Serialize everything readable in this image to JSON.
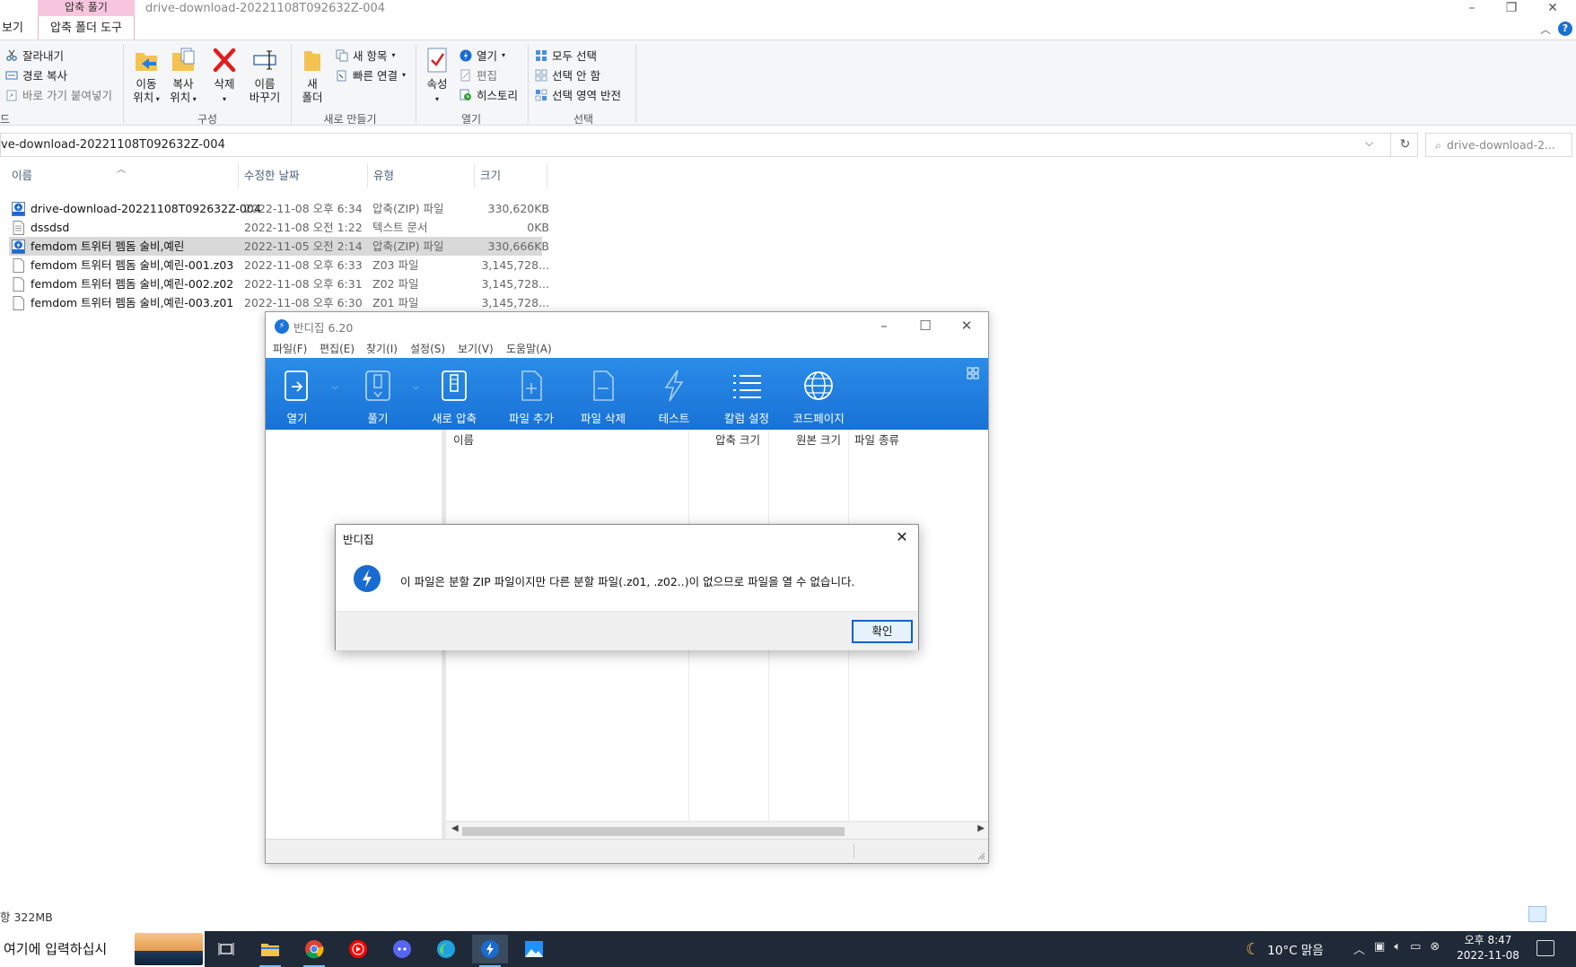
{
  "explorer": {
    "title": "drive-download-20221108T092632Z-004",
    "context_tab_top": "압축 풀기",
    "context_tab": "압축 폴더 도구",
    "view_tab": "보기",
    "ribbon": {
      "clipboard": {
        "cut": "잘라내기",
        "copy_path": "경로 복사",
        "paste_shortcut": "바로 가기 붙여넣기",
        "partial_label": "드"
      },
      "organize": {
        "move_to": "이동\n위치",
        "copy_to": "복사\n위치",
        "delete": "삭제",
        "rename": "이름\n바꾸기",
        "label": "구성"
      },
      "new": {
        "new_folder": "새\n폴더",
        "new_item": "새 항목",
        "easy_access": "빠른 연결",
        "label": "새로 만들기"
      },
      "open": {
        "properties": "속성",
        "open": "열기",
        "edit": "편집",
        "history": "히스토리",
        "label": "열기"
      },
      "select": {
        "select_all": "모두 선택",
        "select_none": "선택 안 함",
        "invert": "선택 영역 반전",
        "label": "선택"
      }
    },
    "address": "ve-download-20221108T092632Z-004",
    "search_placeholder": "drive-download-2...",
    "columns": {
      "name": "이름",
      "date": "수정한 날짜",
      "type": "유형",
      "size": "크기"
    },
    "files": [
      {
        "name": "drive-download-20221108T092632Z-004",
        "date": "2022-11-08 오후 6:34",
        "type": "압축(ZIP) 파일",
        "size": "330,620KB",
        "icon": "zip-icon",
        "selected": false
      },
      {
        "name": "dssdsd",
        "date": "2022-11-08 오전 1:22",
        "type": "텍스트 문서",
        "size": "0KB",
        "icon": "text-file-icon",
        "selected": false
      },
      {
        "name": "femdom 트위터 펨돔 술비,예린",
        "date": "2022-11-05 오전 2:14",
        "type": "압축(ZIP) 파일",
        "size": "330,666KB",
        "icon": "zip-icon",
        "selected": true
      },
      {
        "name": "femdom 트위터 펨돔 술비,예린-001.z03",
        "date": "2022-11-08 오후 6:33",
        "type": "Z03 파일",
        "size": "3,145,728...",
        "icon": "blank-file-icon",
        "selected": false
      },
      {
        "name": "femdom 트위터 펨돔 술비,예린-002.z02",
        "date": "2022-11-08 오후 6:31",
        "type": "Z02 파일",
        "size": "3,145,728...",
        "icon": "blank-file-icon",
        "selected": false
      },
      {
        "name": "femdom 트위터 펨돔 술비,예린-003.z01",
        "date": "2022-11-08 오후 6:30",
        "type": "Z01 파일",
        "size": "3,145,728...",
        "icon": "blank-file-icon",
        "selected": false
      }
    ],
    "status_left": "항 322MB"
  },
  "bandizip": {
    "title": "반디집 6.20",
    "menu": [
      "파일(F)",
      "편집(E)",
      "찾기(I)",
      "설정(S)",
      "보기(V)",
      "도움말(A)"
    ],
    "toolbar": [
      "열기",
      "풀기",
      "새로 압축",
      "파일 추가",
      "파일 삭제",
      "테스트",
      "칼럼 설정",
      "코드페이지"
    ],
    "columns": {
      "name": "이름",
      "packed": "압축 크기",
      "original": "원본 크기",
      "type": "파일 종류"
    },
    "accent": "#1f7fe0"
  },
  "dialog": {
    "title": "반디집",
    "message": "이 파일은 분할 ZIP 파일이지만 다른 분할 파일(.z01, .z02..)이 없으므로 파일을 열 수 없습니다.",
    "ok": "확인"
  },
  "taskbar": {
    "search_text": "여기에 입력하십시",
    "apps": [
      "task-view-icon",
      "file-explorer-icon",
      "chrome-icon",
      "youtube-music-icon",
      "discord-icon",
      "edge-icon",
      "bandizip-icon",
      "photos-icon"
    ],
    "weather": "10°C  맑음",
    "time": "오후 8:47",
    "date": "2022-11-08"
  }
}
